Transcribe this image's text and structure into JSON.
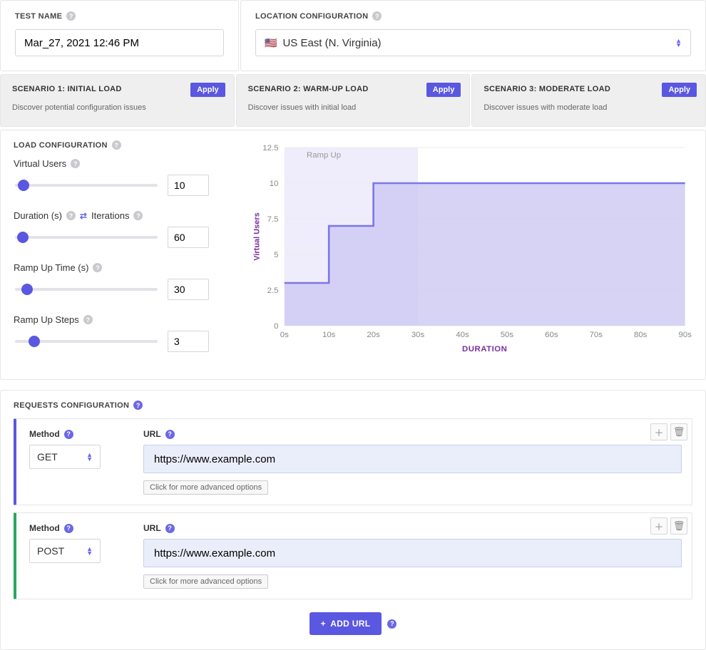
{
  "topRow": {
    "testName": {
      "header": "TEST NAME",
      "value": "Mar_27, 2021 12:46 PM"
    },
    "location": {
      "header": "LOCATION CONFIGURATION",
      "flag": "🇺🇸",
      "value": "US East (N. Virginia)"
    }
  },
  "scenarios": [
    {
      "title": "SCENARIO 1: INITIAL LOAD",
      "desc": "Discover potential configuration issues",
      "apply": "Apply"
    },
    {
      "title": "SCENARIO 2: WARM-UP LOAD",
      "desc": "Discover issues with initial load",
      "apply": "Apply"
    },
    {
      "title": "SCENARIO 3: MODERATE LOAD",
      "desc": "Discover issues with moderate load",
      "apply": "Apply"
    }
  ],
  "loadConfig": {
    "header": "LOAD CONFIGURATION",
    "fields": {
      "virtualUsers": {
        "label": "Virtual Users",
        "value": "10"
      },
      "duration": {
        "label": "Duration (s)",
        "altLabel": "Iterations",
        "value": "60"
      },
      "rampUpTime": {
        "label": "Ramp Up Time (s)",
        "value": "30"
      },
      "rampUpSteps": {
        "label": "Ramp Up Steps",
        "value": "3"
      }
    }
  },
  "chart_data": {
    "type": "area",
    "title": "",
    "xlabel": "DURATION",
    "ylabel": "Virtual Users",
    "x_ticks": [
      "0s",
      "10s",
      "20s",
      "30s",
      "40s",
      "50s",
      "60s",
      "70s",
      "80s",
      "90s"
    ],
    "y_ticks": [
      0,
      2.5,
      5,
      7.5,
      10,
      12.5
    ],
    "ylim": [
      0,
      12.5
    ],
    "xlim": [
      0,
      90
    ],
    "annotations": [
      {
        "text": "Ramp Up",
        "x": 5,
        "y": 12
      }
    ],
    "shaded_region": {
      "x0": 0,
      "x1": 30
    },
    "series": [
      {
        "name": "Virtual Users",
        "points": [
          {
            "x": 0,
            "y": 3
          },
          {
            "x": 10,
            "y": 3
          },
          {
            "x": 10,
            "y": 7
          },
          {
            "x": 20,
            "y": 7
          },
          {
            "x": 20,
            "y": 10
          },
          {
            "x": 90,
            "y": 10
          }
        ]
      }
    ]
  },
  "requests": {
    "header": "REQUESTS CONFIGURATION",
    "methodLabel": "Method",
    "urlLabel": "URL",
    "advancedLabel": "Click for more advanced options",
    "addUrlLabel": "+ ADD URL",
    "items": [
      {
        "method": "GET",
        "url": "https://www.example.com",
        "accent": "get"
      },
      {
        "method": "POST",
        "url": "https://www.example.com",
        "accent": "post"
      }
    ]
  }
}
